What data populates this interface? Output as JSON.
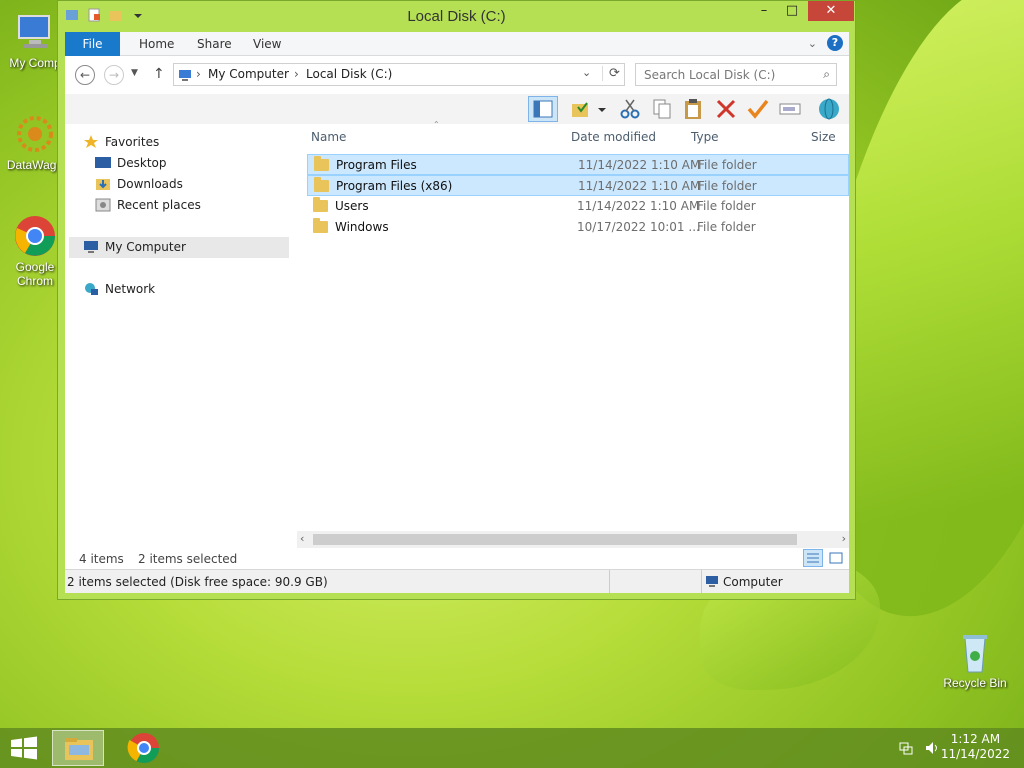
{
  "window": {
    "title": "Local Disk (C:)",
    "controls": {
      "minimize": "–",
      "maximize": "□",
      "close": "✕"
    }
  },
  "ribbon": {
    "tabs": [
      "File",
      "Home",
      "Share",
      "View"
    ]
  },
  "navigation": {
    "back": "←",
    "forward": "→",
    "up": "↑",
    "breadcrumb": [
      "My Computer",
      "Local Disk (C:)"
    ],
    "search_placeholder": "Search Local Disk (C:)"
  },
  "nav_pane": {
    "favorites": "Favorites",
    "favorite_items": [
      "Desktop",
      "Downloads",
      "Recent places"
    ],
    "computer": "My Computer",
    "network": "Network"
  },
  "file_list": {
    "columns": {
      "name": "Name",
      "date": "Date modified",
      "type": "Type",
      "size": "Size"
    },
    "items": [
      {
        "name": "Program Files",
        "date": "11/14/2022 1:10 AM",
        "type": "File folder",
        "selected": true
      },
      {
        "name": "Program Files (x86)",
        "date": "11/14/2022 1:10 AM",
        "type": "File folder",
        "selected": true
      },
      {
        "name": "Users",
        "date": "11/14/2022 1:10 AM",
        "type": "File folder",
        "selected": false
      },
      {
        "name": "Windows",
        "date": "10/17/2022 10:01 ...",
        "type": "File folder",
        "selected": false
      }
    ]
  },
  "info_bar": {
    "item_count": "4 items",
    "selected_count": "2 items selected"
  },
  "status_bar": {
    "left": "2 items selected (Disk free space: 90.9 GB)",
    "right": "Computer"
  },
  "desktop": {
    "icons": [
      "My Comp",
      "DataWago",
      "Google Chrom",
      "Recycle Bin"
    ]
  },
  "taskbar": {
    "time": "1:12 AM",
    "date": "11/14/2022"
  },
  "colors": {
    "accent": "#1979ca",
    "selection": "#cce8ff",
    "window_frame": "#b6e054"
  }
}
